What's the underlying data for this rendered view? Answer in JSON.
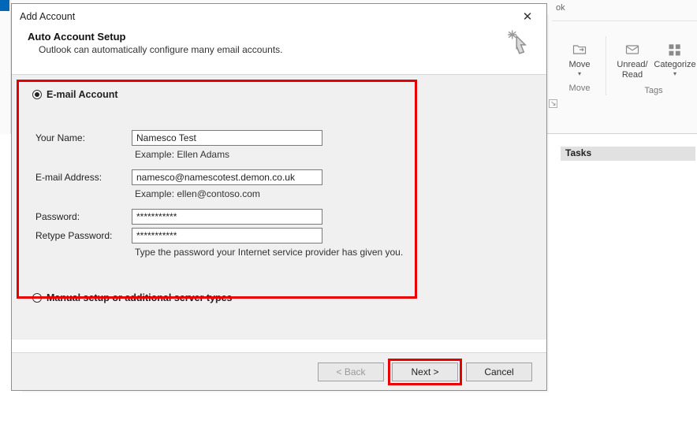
{
  "bg": {
    "ok_fragment": "ok",
    "move": {
      "label": "Move"
    },
    "unread": {
      "label": "Unread/\nRead"
    },
    "categorize": {
      "label": "Categorize"
    },
    "group_move": "Move",
    "group_tags": "Tags",
    "tasks_label": "Tasks"
  },
  "dialog": {
    "title": "Add Account",
    "header_title": "Auto Account Setup",
    "header_sub": "Outlook can automatically configure many email accounts.",
    "option_email": "E-mail Account",
    "option_manual": "Manual setup or additional server types",
    "form": {
      "name_label": "Your Name:",
      "name_value": "Namesco Test",
      "name_example": "Example: Ellen Adams",
      "email_label": "E-mail Address:",
      "email_value": "namesco@namescotest.demon.co.uk",
      "email_example": "Example: ellen@contoso.com",
      "password_label": "Password:",
      "password_value": "***********",
      "retype_label": "Retype Password:",
      "retype_value": "***********",
      "password_hint": "Type the password your Internet service provider has given you."
    },
    "buttons": {
      "back": "< Back",
      "next": "Next >",
      "cancel": "Cancel"
    }
  }
}
